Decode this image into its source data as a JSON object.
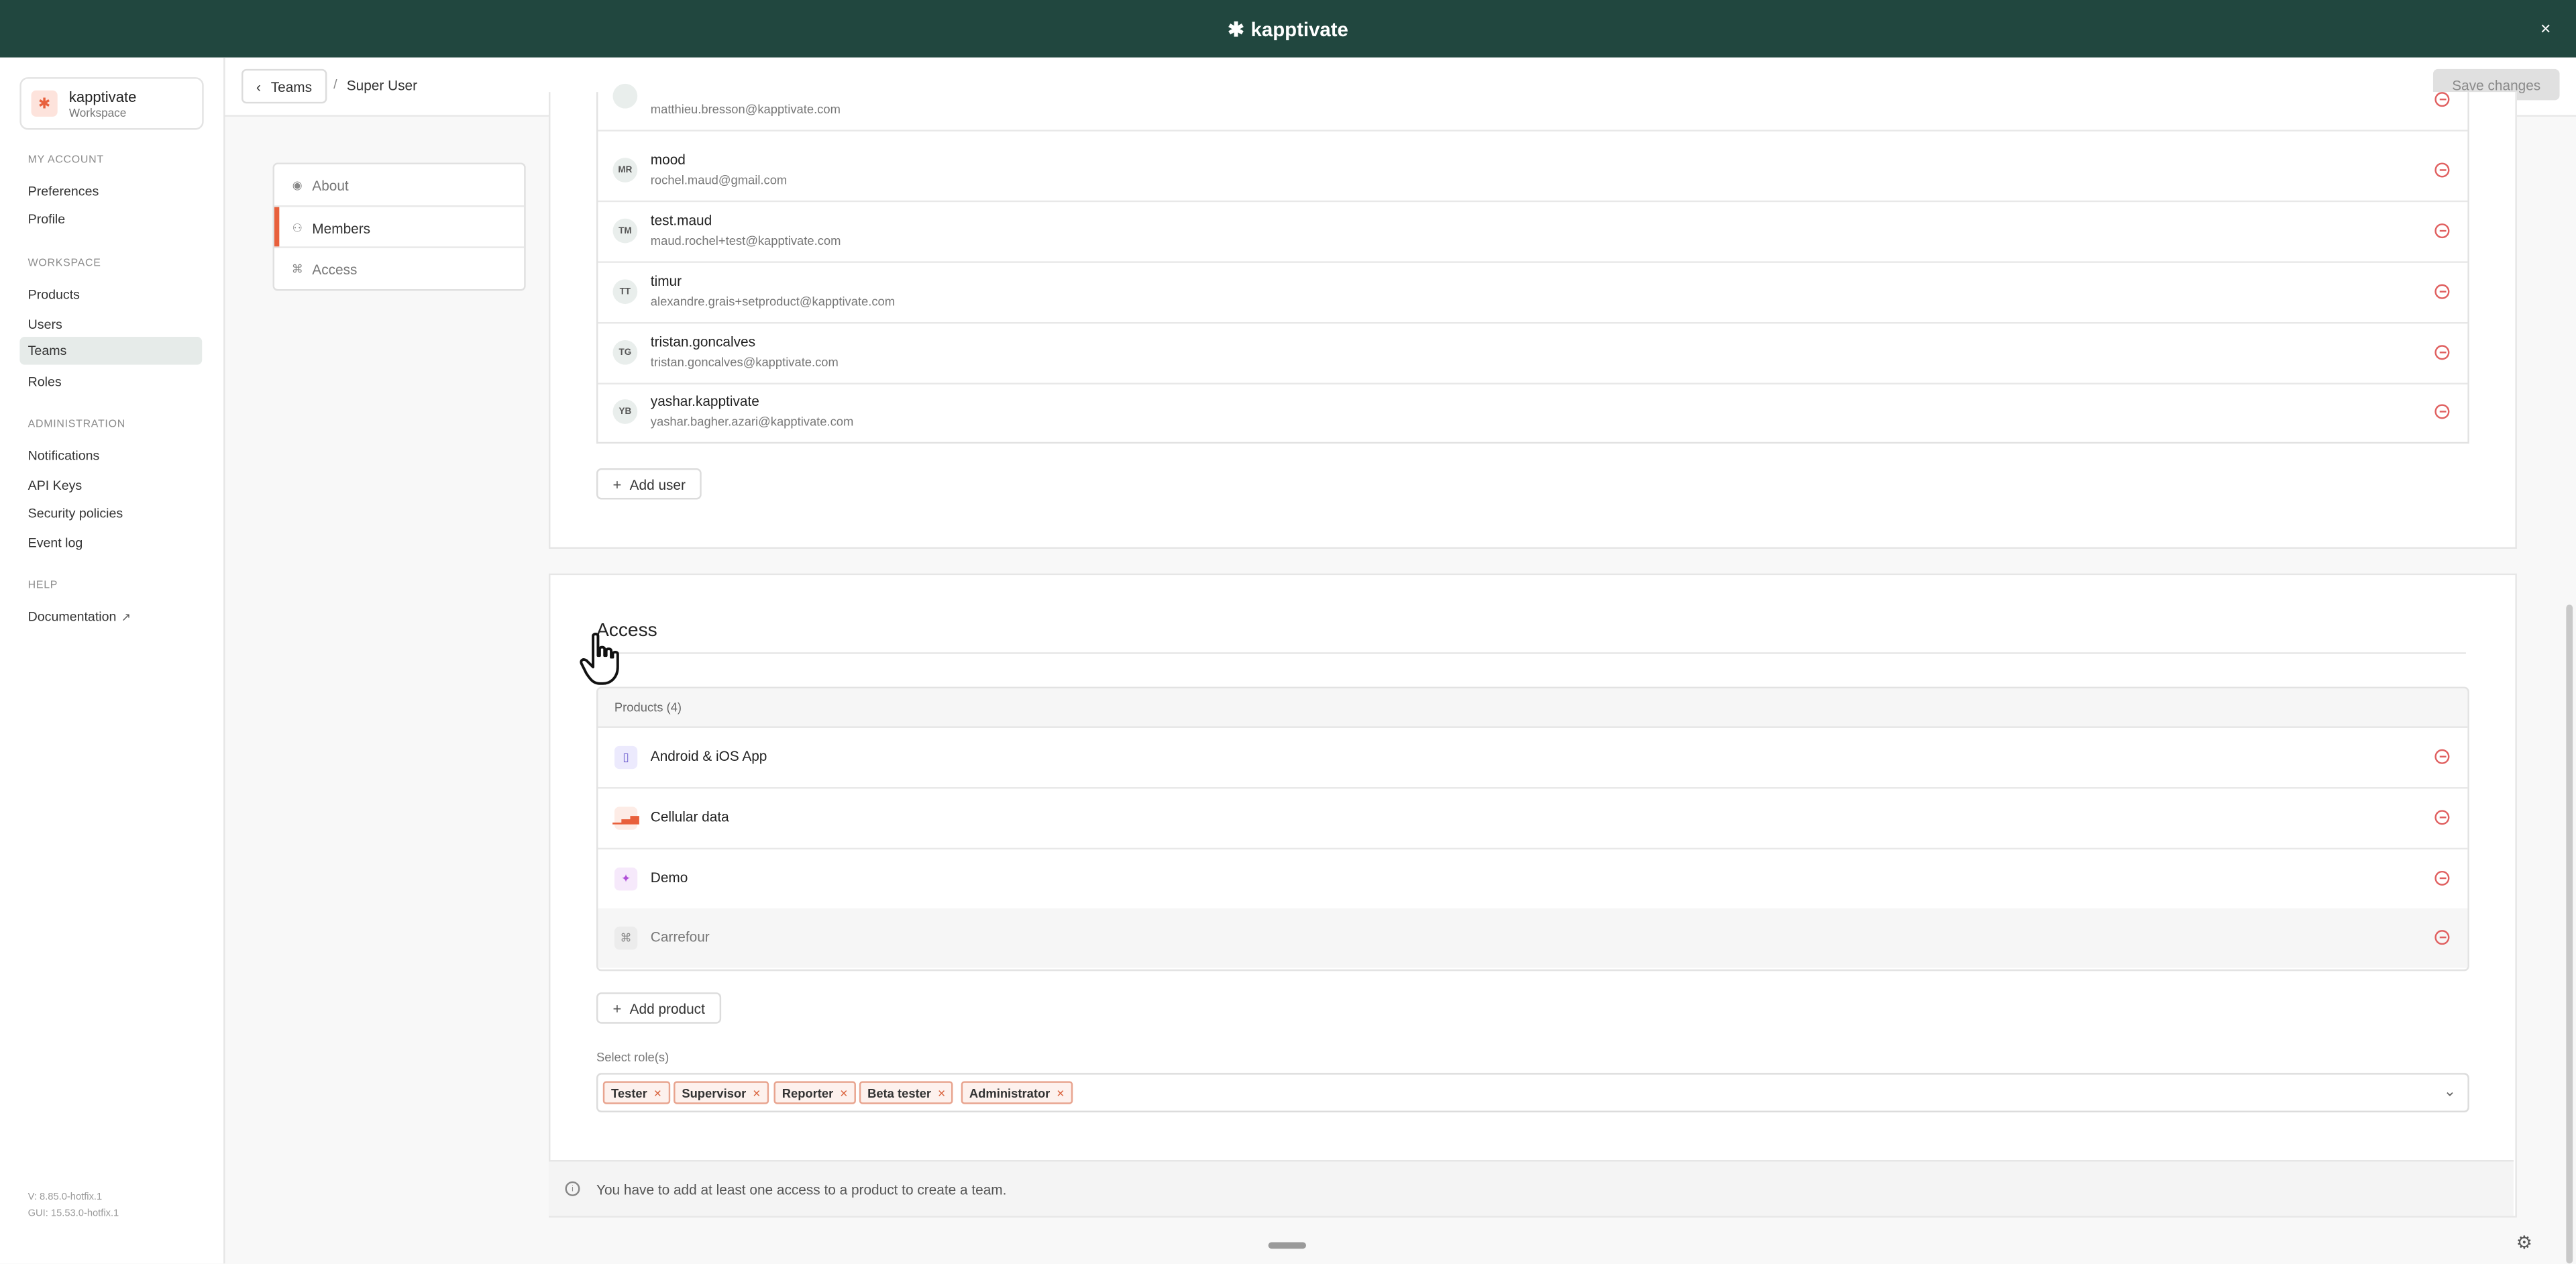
{
  "brand": {
    "name": "kapptivate",
    "mark": "✱"
  },
  "window": {
    "close_icon": "×"
  },
  "workspace": {
    "name": "kapptivate",
    "sub": "Workspace",
    "logo": "✱"
  },
  "sidebar": {
    "sections": [
      {
        "title": "MY ACCOUNT",
        "items": [
          "Preferences",
          "Profile"
        ]
      },
      {
        "title": "WORKSPACE",
        "items": [
          "Products",
          "Users",
          "Teams",
          "Roles"
        ]
      },
      {
        "title": "ADMINISTRATION",
        "items": [
          "Notifications",
          "API Keys",
          "Security policies",
          "Event log"
        ]
      },
      {
        "title": "HELP",
        "items": [
          "Documentation"
        ]
      }
    ],
    "active_item": "Teams",
    "version": "V: 8.85.0-hotfix.1",
    "gui_version": "GUI: 15.53.0-hotfix.1"
  },
  "header": {
    "back_label": "Teams",
    "separator": "/",
    "current": "Super User",
    "save_label": "Save changes"
  },
  "tabs": [
    {
      "label": "About",
      "icon": "eye-icon"
    },
    {
      "label": "Members",
      "icon": "users-icon"
    },
    {
      "label": "Access",
      "icon": "command-icon"
    }
  ],
  "active_tab": "Members",
  "members": [
    {
      "initials": "",
      "name": "",
      "email": "matthieu.bresson@kapptivate.com"
    },
    {
      "initials": "MR",
      "name": "mood",
      "email": "rochel.maud@gmail.com"
    },
    {
      "initials": "TM",
      "name": "test.maud",
      "email": "maud.rochel+test@kapptivate.com"
    },
    {
      "initials": "TT",
      "name": "timur",
      "email": "alexandre.grais+setproduct@kapptivate.com"
    },
    {
      "initials": "TG",
      "name": "tristan.goncalves",
      "email": "tristan.goncalves@kapptivate.com"
    },
    {
      "initials": "YB",
      "name": "yashar.kapptivate",
      "email": "yashar.bagher.azari@kapptivate.com"
    }
  ],
  "add_user_label": "Add user",
  "access": {
    "title": "Access",
    "products_header": "Products (4)",
    "products": [
      {
        "name": "Android & iOS App",
        "icon": "phone-icon",
        "color": "#6a5acd",
        "bg": "#eceafd"
      },
      {
        "name": "Cellular data",
        "icon": "signal-icon",
        "color": "#e8603c",
        "bg": "#fdece6"
      },
      {
        "name": "Demo",
        "icon": "sparkle-icon",
        "color": "#b04fd8",
        "bg": "#f6e9fb"
      },
      {
        "name": "Carrefour",
        "icon": "command-icon",
        "color": "#888888",
        "bg": "#ececec"
      }
    ],
    "add_product_label": "Add product",
    "roles_label": "Select role(s)",
    "roles": [
      "Tester",
      "Supervisor",
      "Reporter",
      "Beta tester",
      "Administrator"
    ]
  },
  "info_message": "You have to add at least one access to a product to create a team."
}
